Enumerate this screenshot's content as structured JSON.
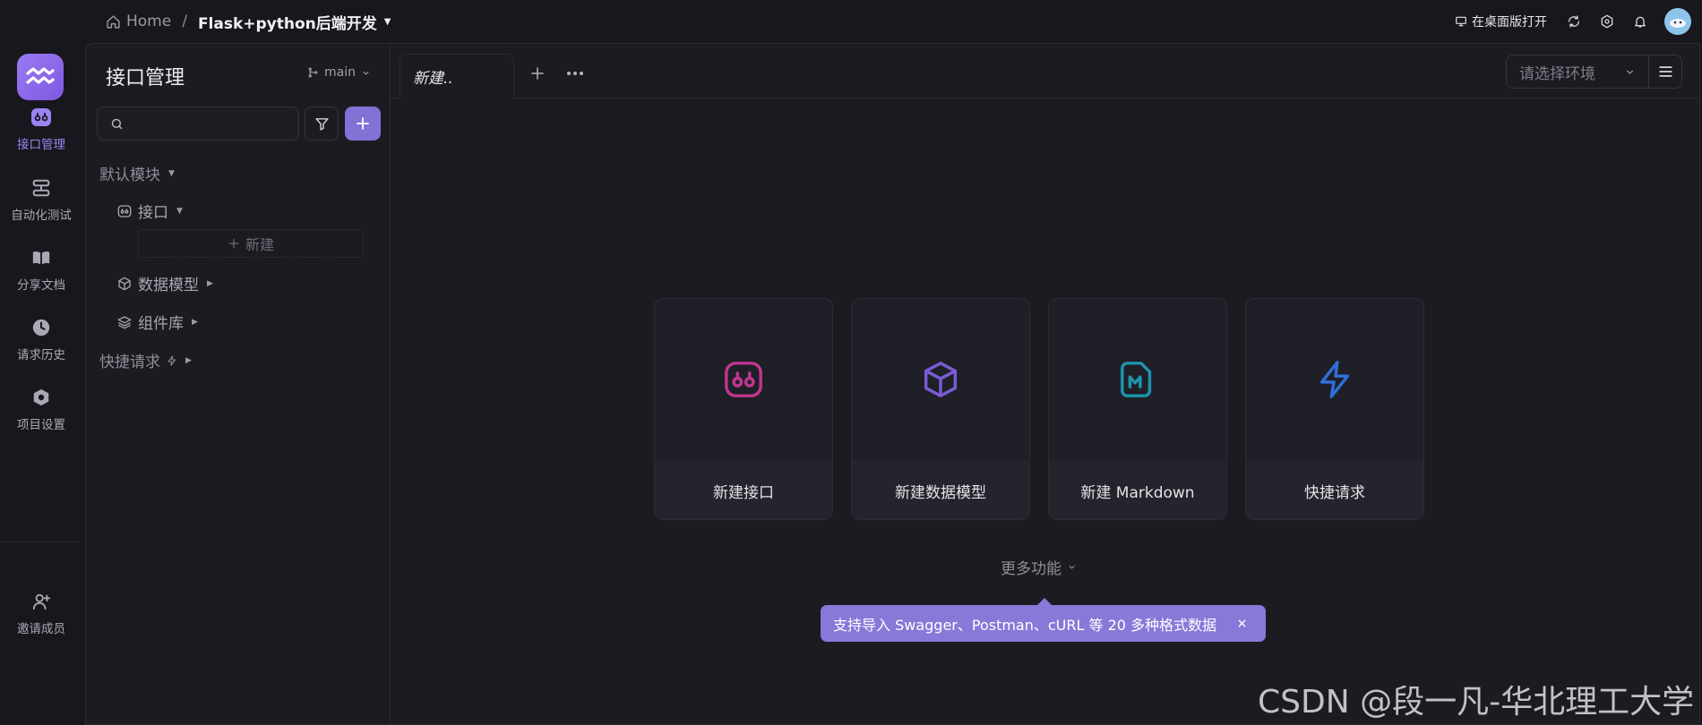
{
  "topbar": {
    "home_label": "Home",
    "separator": "/",
    "project_name": "Flask+python后端开发",
    "open_desktop_label": "在桌面版打开"
  },
  "rail": {
    "items": [
      {
        "label": "接口管理",
        "icon": "api-icon",
        "active": true
      },
      {
        "label": "自动化测试",
        "icon": "automation-icon"
      },
      {
        "label": "分享文档",
        "icon": "book-icon"
      },
      {
        "label": "请求历史",
        "icon": "clock-icon"
      },
      {
        "label": "项目设置",
        "icon": "gear-icon"
      },
      {
        "label": "邀请成员",
        "icon": "user-add-icon"
      }
    ]
  },
  "sidebar": {
    "title": "接口管理",
    "branch": "main",
    "search_placeholder": "",
    "tree": {
      "default_module": "默认模块",
      "api": "接口",
      "new": "新建",
      "data_model": "数据模型",
      "components": "组件库",
      "quick_request": "快捷请求"
    }
  },
  "tabs": {
    "active_tab": "新建..",
    "env_placeholder": "请选择环境"
  },
  "cards": [
    {
      "label": "新建接口",
      "icon": "api-icon",
      "color": "#c0368f"
    },
    {
      "label": "新建数据模型",
      "icon": "cube-icon",
      "color": "#7a5bd6"
    },
    {
      "label": "新建 Markdown",
      "icon": "markdown-icon",
      "color": "#1f93ad"
    },
    {
      "label": "快捷请求",
      "icon": "lightning-icon",
      "color": "#2f6fd8"
    }
  ],
  "more_functions": "更多功能",
  "tip": "支持导入 Swagger、Postman、cURL 等 20 多种格式数据",
  "watermark": "CSDN @段一凡-华北理工大学",
  "colors": {
    "accent": "#8471d6",
    "background": "#17171d",
    "panel": "#1b1b22"
  }
}
